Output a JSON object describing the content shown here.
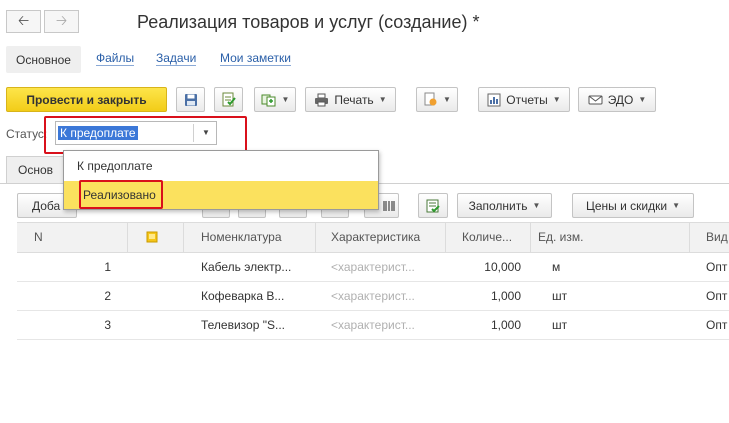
{
  "header": {
    "title": "Реализация товаров и услуг (создание) *",
    "back_icon": "arrow-left-icon",
    "forward_icon": "arrow-right-icon"
  },
  "tabs": {
    "main": "Основное",
    "files": "Файлы",
    "tasks": "Задачи",
    "notes": "Мои заметки"
  },
  "toolbar": {
    "post_close": "Провести и закрыть",
    "print": "Печать",
    "reports": "Отчеты",
    "edo": "ЭДО"
  },
  "status": {
    "label": "Статус:",
    "value": "К предоплате",
    "options": [
      "К предоплате",
      "Реализовано"
    ]
  },
  "tab_partial": "Основ",
  "grid_toolbar": {
    "add_partial": "Доба",
    "fill": "Заполнить",
    "prices": "Цены и скидки"
  },
  "table": {
    "columns": [
      "N",
      "",
      "Номенклатура",
      "Характеристика",
      "Количе...",
      "Ед. изм.",
      "Вид"
    ],
    "rows": [
      {
        "n": "1",
        "item": "Кабель электр...",
        "char": "<характерист...",
        "qty": "10,000",
        "unit": "м",
        "kind": "Опт"
      },
      {
        "n": "2",
        "item": "Кофеварка В...",
        "char": "<характерист...",
        "qty": "1,000",
        "unit": "шт",
        "kind": "Опт"
      },
      {
        "n": "3",
        "item": "Телевизор \"S...",
        "char": "<характерист...",
        "qty": "1,000",
        "unit": "шт",
        "kind": "Опт"
      }
    ]
  },
  "colors": {
    "accent_yellow": "#f7d51d",
    "highlight_red": "#d9101b",
    "selection_blue": "#3c78d8",
    "link_blue": "#2a5fa8"
  }
}
